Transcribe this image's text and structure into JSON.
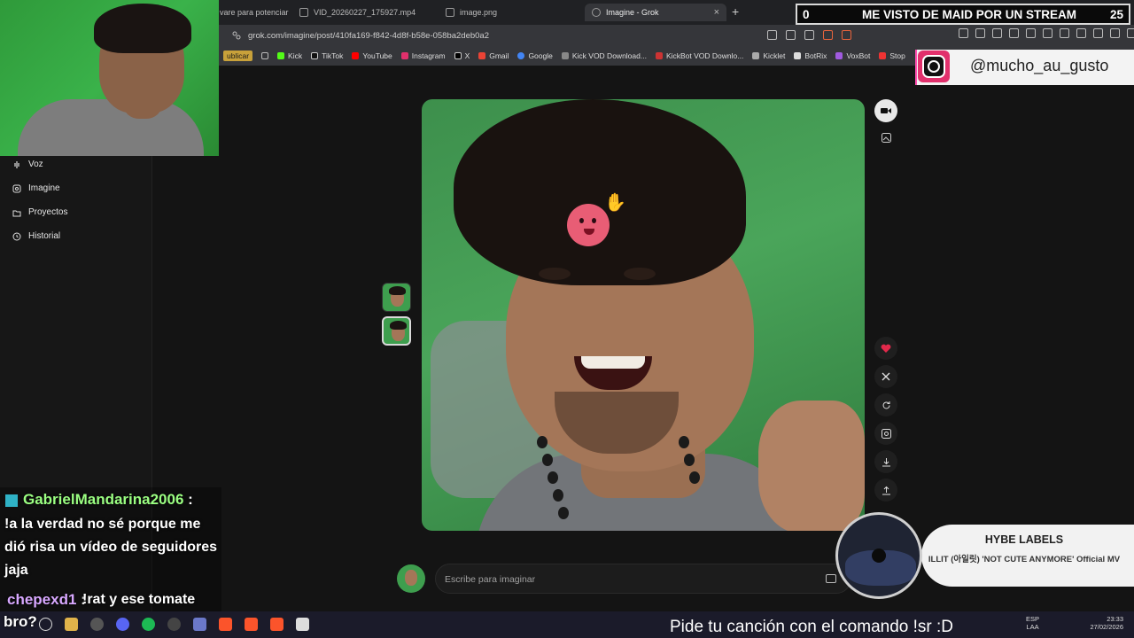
{
  "browser": {
    "tabs": [
      {
        "label": "vare para potenciar",
        "active": false
      },
      {
        "label": "VID_20260227_175927.mp4",
        "active": false
      },
      {
        "label": "image.png",
        "active": false
      },
      {
        "label": "Imagine - Grok",
        "active": true
      }
    ],
    "close_glyph": "×",
    "new_tab_glyph": "+",
    "url": "grok.com/imagine/post/410fa169-f842-4d8f-b58e-058ba2deb0a2",
    "bookmarks": [
      "ublicar",
      "Kick",
      "TikTok",
      "YouTube",
      "Instagram",
      "X",
      "Gmail",
      "Google",
      "Kick VOD Download...",
      "KickBot VOD Downlo...",
      "Kicklet",
      "BotRix",
      "VoxBot",
      "Stop"
    ]
  },
  "sidebar": {
    "items": [
      {
        "label": "Voz",
        "icon": "voice-icon"
      },
      {
        "label": "Imagine",
        "icon": "image-icon"
      },
      {
        "label": "Proyectos",
        "icon": "folder-icon"
      },
      {
        "label": "Historial",
        "icon": "history-icon"
      }
    ]
  },
  "prompt": {
    "placeholder": "Escribe para imaginar"
  },
  "overlay": {
    "counter_left": "0",
    "stream_title": "ME VISTO DE MAID POR UN STREAM",
    "counter_right": "25",
    "instagram_handle": "@mucho_au_gusto",
    "chat": [
      {
        "user": "GabrielMandarina2006",
        "separator": ":",
        "message": "!a la verdad no sé porque me dió risa un vídeo de seguidores jaja"
      },
      {
        "user": "chepexd1",
        "separator": ":",
        "message": "!rat y ese tomate"
      }
    ],
    "chat_trailing": "bro?",
    "music": {
      "artist": "HYBE LABELS",
      "song": "ILLIT (아일릿) 'NOT CUTE ANYMORE' Official MV"
    },
    "song_request": "Pide tu canción con el comando !sr :D"
  },
  "taskbar": {
    "lang": "ESP",
    "lang_sub": "LAA",
    "time": "23:33",
    "date": "27/02/2026"
  },
  "colors": {
    "accent_heart": "#e2294b",
    "chat_user1": "#9bff82",
    "chat_user2": "#d8a8ff",
    "instagram_pink": "#e1306c"
  }
}
